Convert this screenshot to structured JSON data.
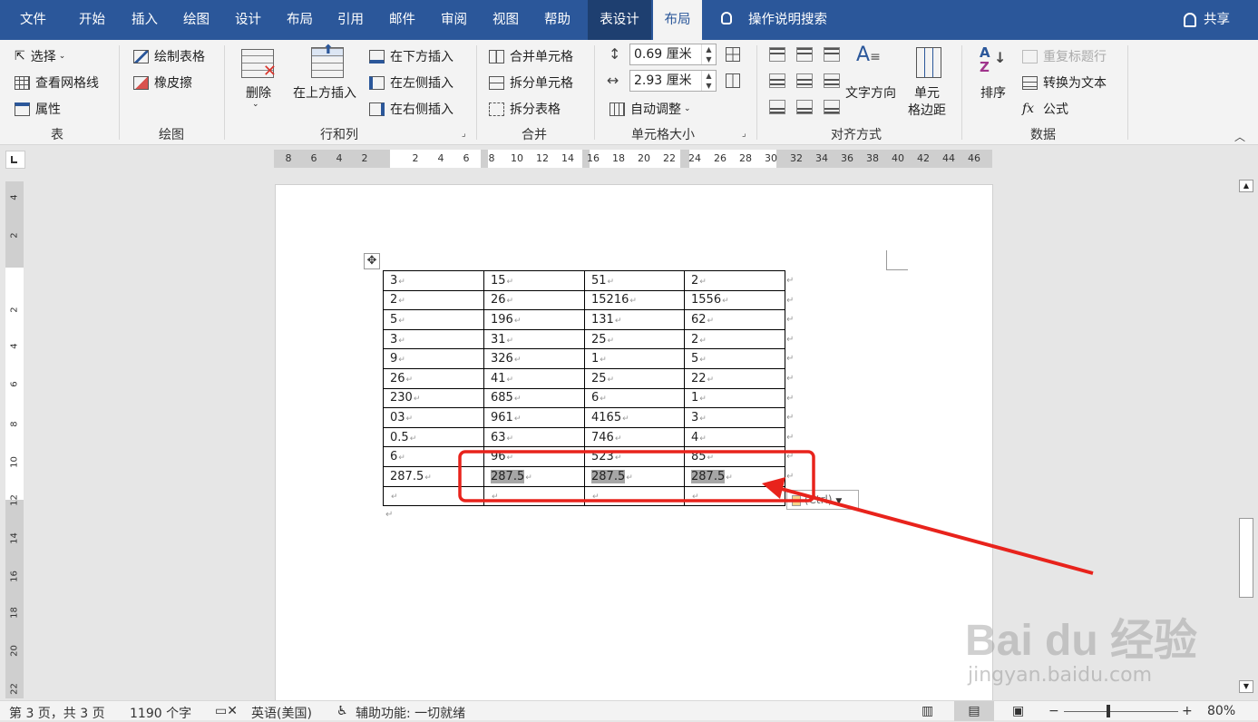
{
  "tabs": [
    "文件",
    "开始",
    "插入",
    "绘图",
    "设计",
    "布局",
    "引用",
    "邮件",
    "审阅",
    "视图",
    "帮助",
    "表设计",
    "布局"
  ],
  "tell_me": "操作说明搜索",
  "share": "共享",
  "ribbon": {
    "table": {
      "select": "选择",
      "gridlines": "查看网格线",
      "properties": "属性",
      "label": "表"
    },
    "draw": {
      "draw_table": "绘制表格",
      "eraser": "橡皮擦",
      "label": "绘图"
    },
    "rows_cols": {
      "delete": "删除",
      "insert_above": "在上方插入",
      "insert_below": "在下方插入",
      "insert_left": "在左侧插入",
      "insert_right": "在右侧插入",
      "label": "行和列"
    },
    "merge": {
      "merge_cells": "合并单元格",
      "split_cells": "拆分单元格",
      "split_table": "拆分表格",
      "label": "合并"
    },
    "cell_size": {
      "height": "0.69 厘米",
      "width": "2.93 厘米",
      "autofit": "自动调整",
      "label": "单元格大小"
    },
    "alignment": {
      "text_direction": "文字方向",
      "cell_margins_1": "单元",
      "cell_margins_2": "格边距",
      "label": "对齐方式"
    },
    "data": {
      "sort": "排序",
      "repeat_header": "重复标题行",
      "convert_text": "转换为文本",
      "formula": "公式",
      "label": "数据"
    }
  },
  "ruler_h": [
    "8",
    "6",
    "4",
    "2",
    "2",
    "4",
    "6",
    "8",
    "10",
    "12",
    "14",
    "16",
    "18",
    "20",
    "22",
    "24",
    "26",
    "28",
    "30",
    "32",
    "34",
    "36",
    "38",
    "40",
    "42",
    "44",
    "46"
  ],
  "ruler_v": [
    "4",
    "2",
    "2",
    "4",
    "6",
    "8",
    "10",
    "12",
    "14",
    "16",
    "18",
    "20",
    "22"
  ],
  "table_rows": [
    [
      "3",
      "15",
      "51",
      "2"
    ],
    [
      "2",
      "26",
      "15216",
      "1556"
    ],
    [
      "5",
      "196",
      "131",
      "62"
    ],
    [
      "3",
      "31",
      "25",
      "2"
    ],
    [
      "9",
      "326",
      "1",
      "5"
    ],
    [
      "26",
      "41",
      "25",
      "22"
    ],
    [
      "230",
      "685",
      "6",
      "1"
    ],
    [
      "03",
      "961",
      "4165",
      "3"
    ],
    [
      "0.5",
      "63",
      "746",
      "4"
    ],
    [
      "6",
      "96",
      "523",
      "85"
    ],
    [
      "287.5",
      "287.5",
      "287.5",
      "287.5"
    ],
    [
      "",
      "",
      "",
      ""
    ]
  ],
  "paste_tag": "(Ctrl)",
  "watermark": {
    "logo": "Bai du 经验",
    "url": "jingyan.baidu.com"
  },
  "status": {
    "page": "第 3 页，共 3 页",
    "words": "1190 个字",
    "lang": "英语(美国)",
    "access": "辅助功能: 一切就绪",
    "zoom": "80%"
  },
  "colors": {
    "title_blue": "#2b579a",
    "annotation_red": "#e8231c"
  }
}
